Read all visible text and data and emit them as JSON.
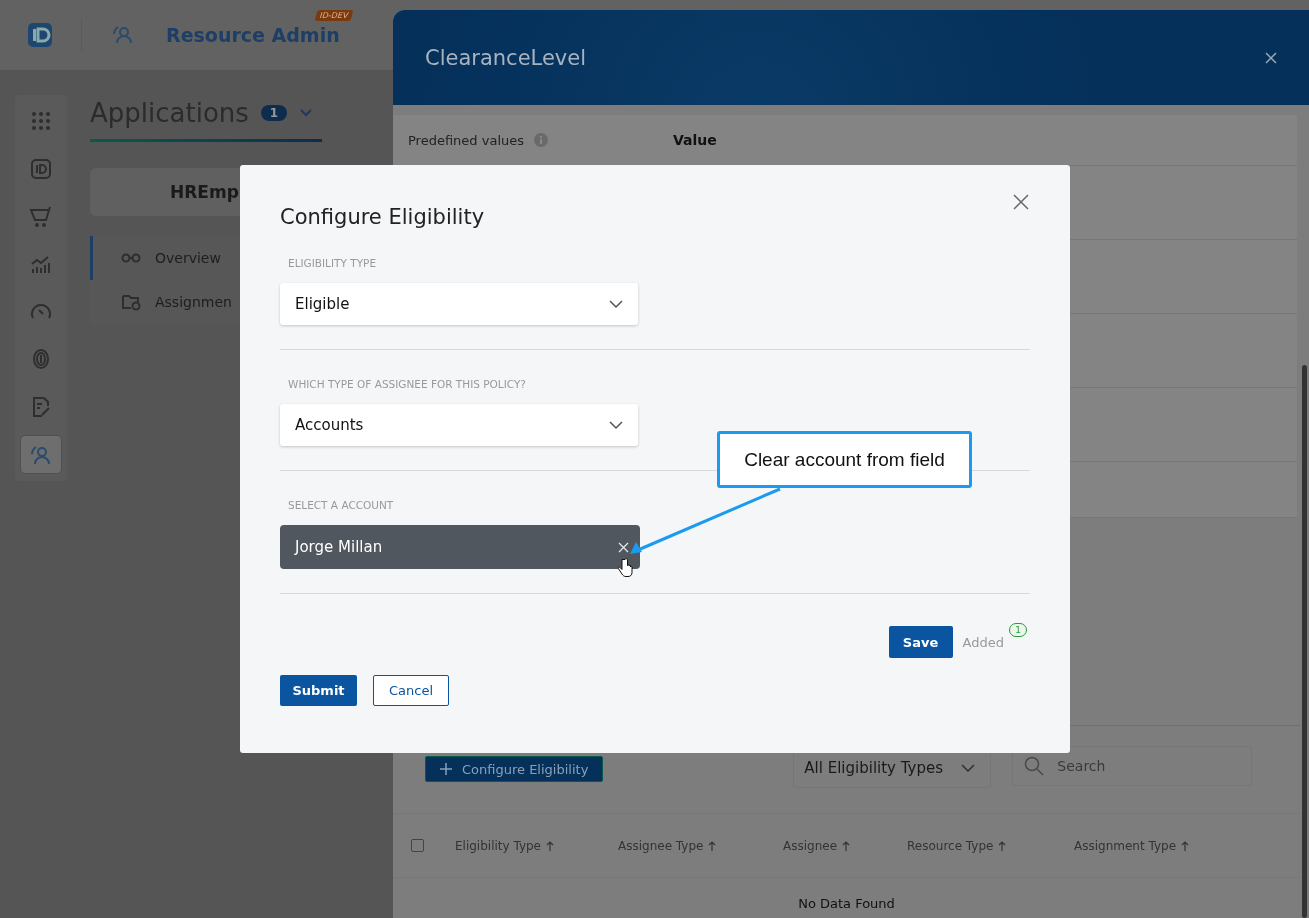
{
  "app_header": {
    "title": "Resource Admin",
    "env_badge": "ID-DEV"
  },
  "rail_items": [
    {
      "kind": "apps",
      "selected": false
    },
    {
      "kind": "id",
      "selected": false
    },
    {
      "kind": "cart",
      "selected": false
    },
    {
      "kind": "chart",
      "selected": false
    },
    {
      "kind": "gauge",
      "selected": false
    },
    {
      "kind": "fingerprint",
      "selected": false
    },
    {
      "kind": "form",
      "selected": false
    },
    {
      "kind": "resource",
      "selected": true
    }
  ],
  "page": {
    "title": "Applications",
    "count": "1",
    "card_title": "HREmp",
    "nav": [
      {
        "label": "Overview",
        "kind": "glasses",
        "selected": true
      },
      {
        "label": "Assignmen",
        "kind": "folder",
        "selected": false
      }
    ]
  },
  "drawer": {
    "title": "ClearanceLevel",
    "predefined_label": "Predefined values",
    "value_header": "Value",
    "configure_button": "Configure Eligibility",
    "type_filter": "All Eligibility Types",
    "search": {
      "placeholder": "Search"
    },
    "select_all": {
      "checked": false
    },
    "columns": [
      "Eligibility Type",
      "Assignee Type",
      "Assignee",
      "Resource Type",
      "Assignment Type"
    ],
    "empty": "No Data Found"
  },
  "modal": {
    "title": "Configure Eligibility",
    "sections": [
      {
        "label": "ELIGIBILITY TYPE",
        "kind": "dropdown",
        "value": "Eligible"
      },
      {
        "label": "WHICH TYPE OF ASSIGNEE FOR THIS POLICY?",
        "kind": "dropdown",
        "value": "Accounts"
      },
      {
        "label": "SELECT A ACCOUNT",
        "kind": "chip",
        "value": "Jorge Millan"
      }
    ],
    "save": "Save",
    "added": "Added",
    "added_count": "1",
    "submit": "Submit",
    "cancel": "Cancel"
  },
  "callout": {
    "text": "Clear account from field"
  }
}
